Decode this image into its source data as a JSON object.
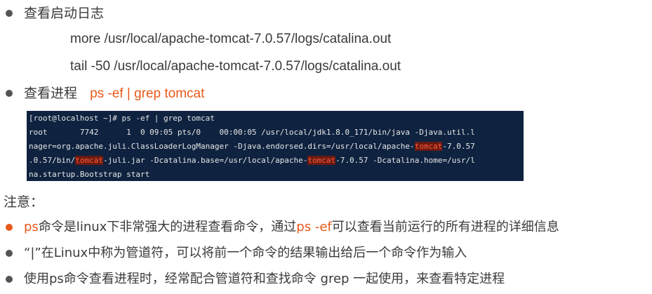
{
  "section1": {
    "heading": "查看启动日志",
    "cmd_more": "more /usr/local/apache-tomcat-7.0.57/logs/catalina.out",
    "cmd_tail": "tail -50 /usr/local/apache-tomcat-7.0.57/logs/catalina.out"
  },
  "section2": {
    "heading": "查看进程",
    "cmd": "ps -ef | grep tomcat"
  },
  "terminal": {
    "line1": "[root@localhost ~]# ps -ef | grep tomcat",
    "line2": "root       7742      1  0 09:05 pts/0    00:00:05 /usr/local/jdk1.8.0_171/bin/java -Djava.util.l",
    "line3_a": "nager=org.apache.juli.ClassLoaderLogManager -Djava.endorsed.dirs=/usr/local/apache-",
    "line3_hl": "tomcat",
    "line3_b": "-7.0.57",
    "line4_a": ".0.57/bin/",
    "line4_hl1": "tomcat",
    "line4_b": "-juli.jar -Dcatalina.base=/usr/local/apache-",
    "line4_hl2": "tomcat",
    "line4_c": "-7.0.57 -Dcatalina.home=/usr/l",
    "line5": "na.startup.Bootstrap start"
  },
  "notes": {
    "title": "注意：",
    "item1_ps": "ps",
    "item1_a": "命令是linux下非常强大的进程查看命令，通过",
    "item1_psef": "ps -ef",
    "item1_b": "可以查看当前运行的所有进程的详细信息",
    "item2": "“|”在Linux中称为管道符，可以将前一个命令的结果输出给后一个命令作为输入",
    "item3": "使用ps命令查看进程时，经常配合管道符和查找命令 grep 一起使用，来查看特定进程"
  },
  "colors": {
    "accent": "#e8591a",
    "terminal_bg": "#0f2340",
    "highlight": "#ff5a3a"
  }
}
